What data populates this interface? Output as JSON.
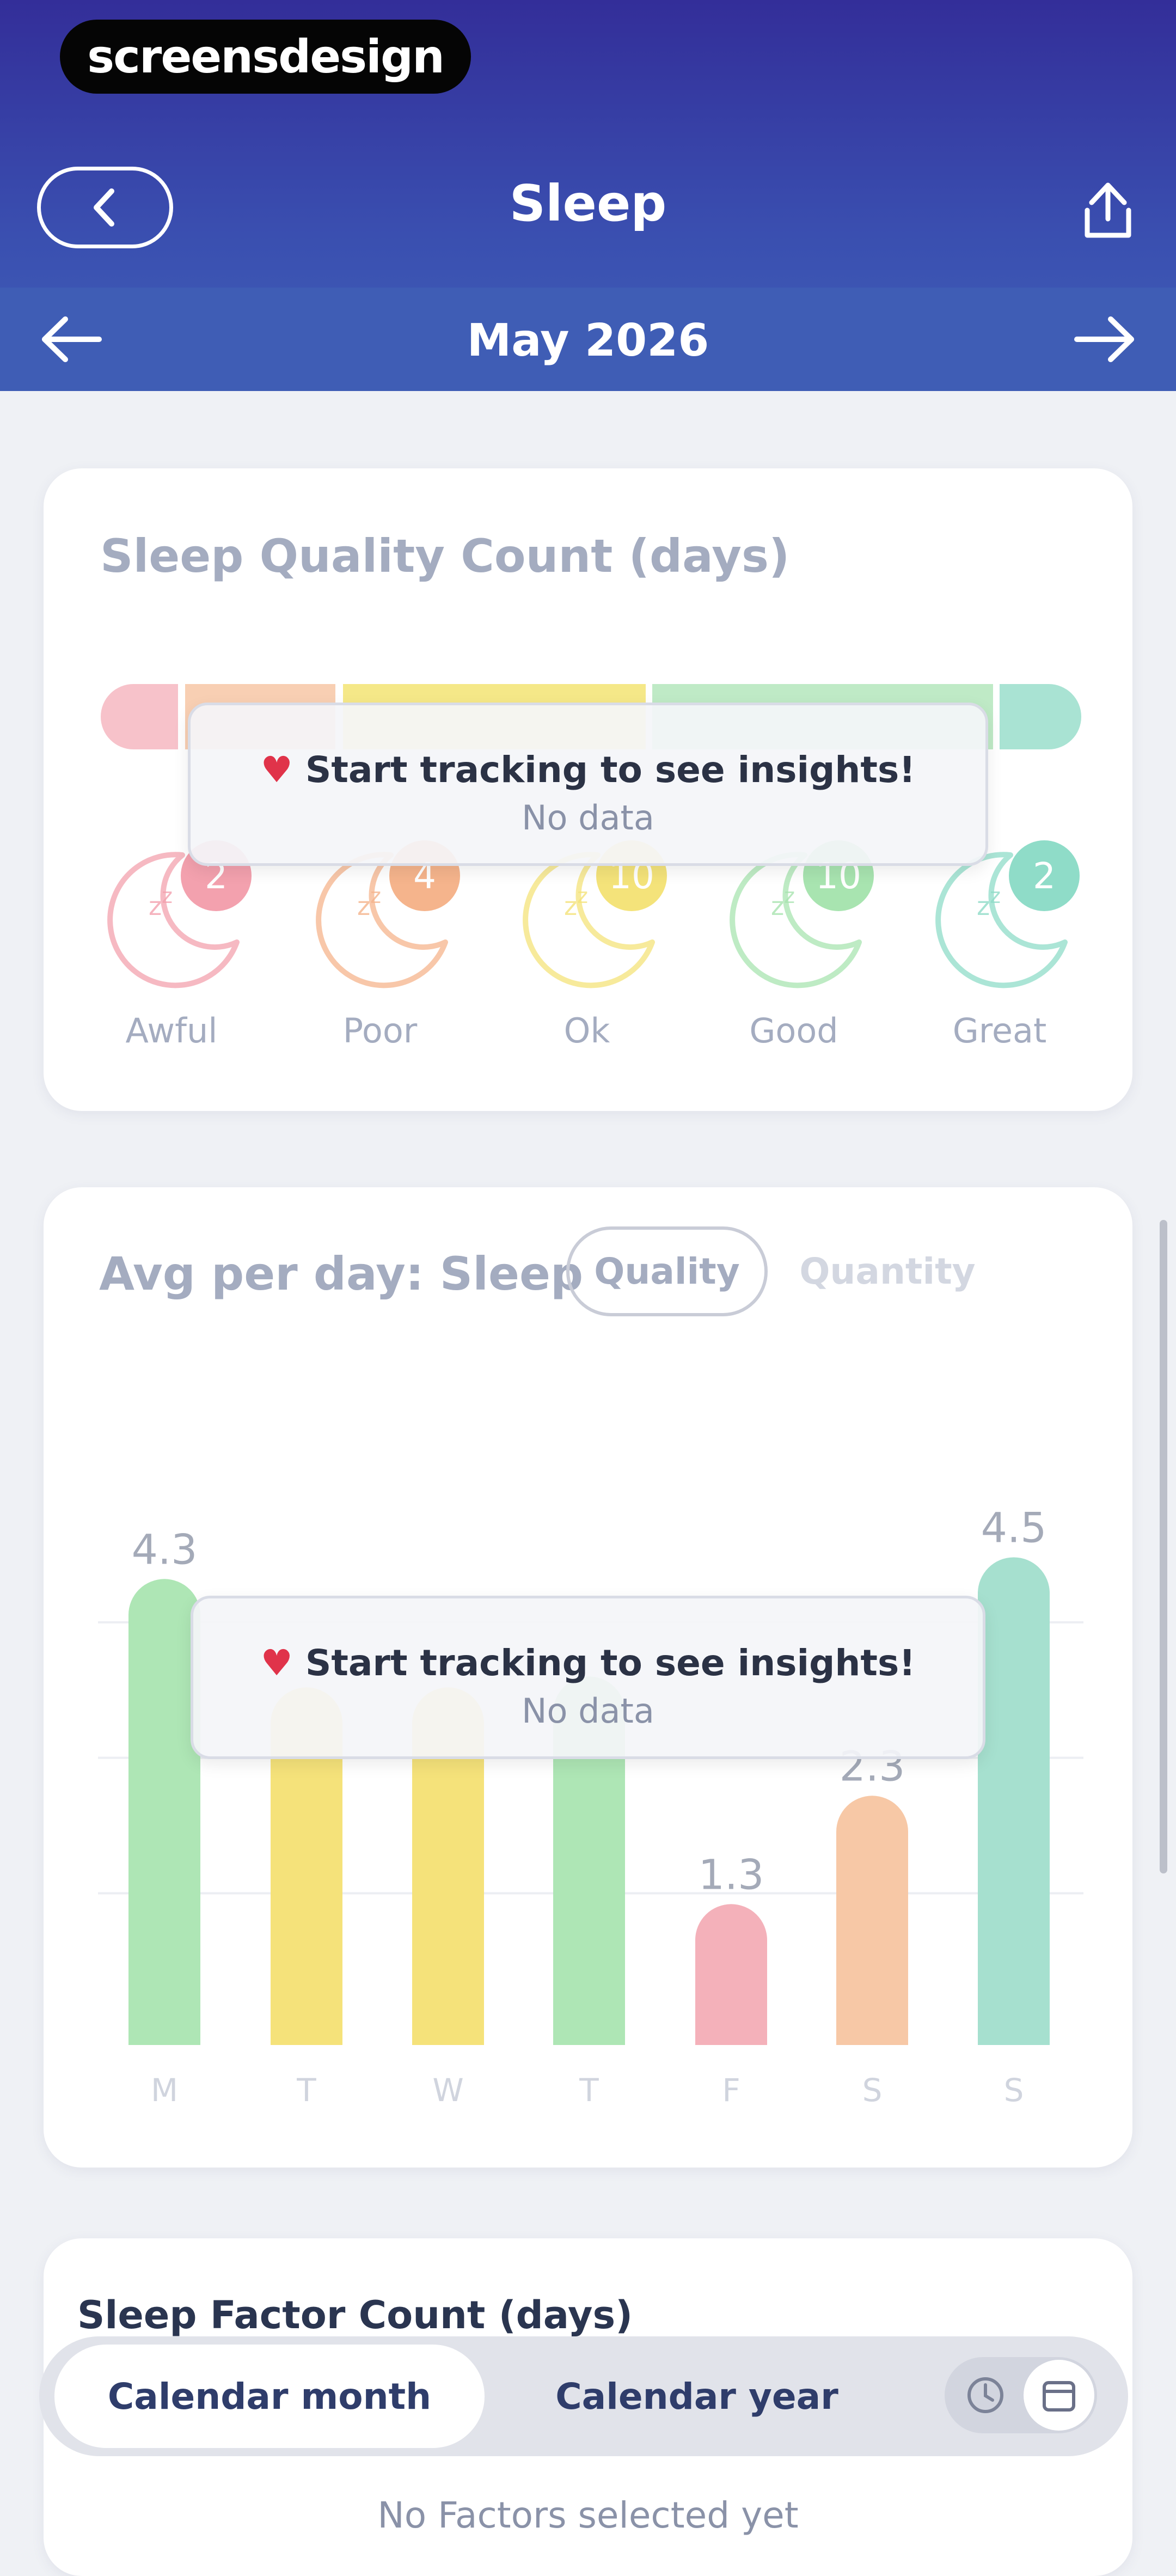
{
  "brand": {
    "text": "screensdesign"
  },
  "header": {
    "title": "Sleep",
    "month": "May 2026"
  },
  "quality_card": {
    "title": "Sleep Quality Count (days)",
    "overlay": {
      "message": "Start tracking to see insights!",
      "sub": "No data"
    },
    "levels": [
      {
        "label": "Awful",
        "color": "#f3a1ae",
        "badge": "2"
      },
      {
        "label": "Poor",
        "color": "#f5b48c",
        "badge": "4"
      },
      {
        "label": "Ok",
        "color": "#f4e37a",
        "badge": "10"
      },
      {
        "label": "Good",
        "color": "#a8e4b0",
        "badge": "10"
      },
      {
        "label": "Great",
        "color": "#8fdcc8",
        "badge": "2"
      }
    ]
  },
  "avg_card": {
    "title": "Avg per day: Sleep",
    "toggle": {
      "quality": "Quality",
      "quantity": "Quantity"
    },
    "overlay": {
      "message": "Start tracking to see insights!",
      "sub": "No data"
    }
  },
  "chart_data": {
    "type": "bar",
    "categories": [
      "M",
      "T",
      "W",
      "T",
      "F",
      "S",
      "S"
    ],
    "values": [
      4.3,
      3.3,
      3.3,
      3.4,
      1.3,
      2.3,
      4.5
    ],
    "value_labels": [
      "4.3",
      "",
      "",
      "",
      "1.3",
      "2.3",
      "4.5"
    ],
    "colors": [
      "#aee6b5",
      "#f5e27a",
      "#f5e27a",
      "#aee6b5",
      "#f4b1ba",
      "#f7c8a6",
      "#a6e0cf"
    ],
    "ylim": [
      0,
      5
    ],
    "grid": true
  },
  "factor_card": {
    "title": "Sleep Factor Count (days)",
    "empty": "No Factors selected yet"
  },
  "range_selector": {
    "month": "Calendar month",
    "year": "Calendar year"
  },
  "icons": {
    "back": "chevron-left-icon",
    "share": "share-icon",
    "prev": "arrow-left-icon",
    "next": "arrow-right-icon",
    "heart": "heart-icon",
    "moon": "moon-icon",
    "clock": "clock-icon",
    "calendar": "calendar-icon"
  }
}
